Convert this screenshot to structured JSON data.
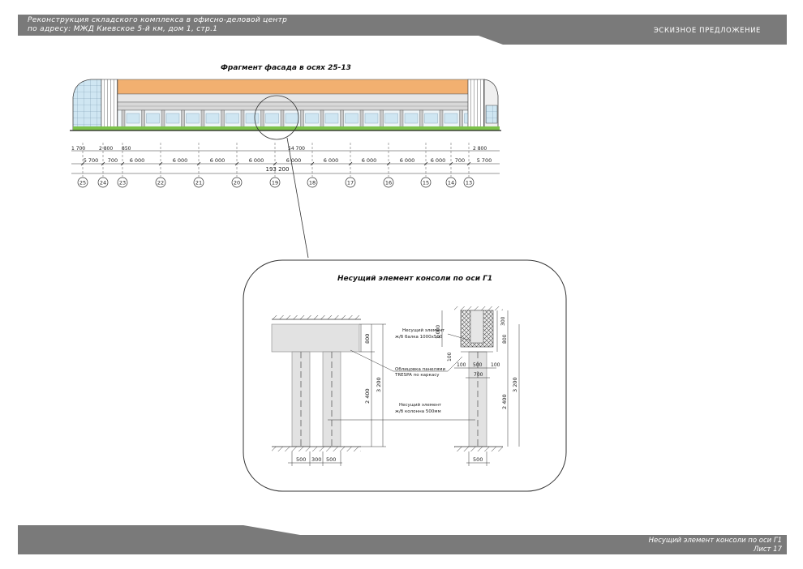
{
  "header": {
    "project_line1": "Реконструкция складского комплекса в офисно-деловой центр",
    "project_line2": "по адресу: МЖД Киевское 5-й км, дом 1, стр.1",
    "stage": "ЭСКИЗНОЕ ПРЕДЛОЖЕНИЕ"
  },
  "facade": {
    "title": "Фрагмент фасада в осях 25-13",
    "dims_top": [
      "1 700",
      "2 800",
      "850",
      "54 700",
      "2 800"
    ],
    "dims_spans": [
      "5 700",
      "700",
      "6 000",
      "6 000",
      "6 000",
      "6 000",
      "6 000",
      "6 000",
      "6 000",
      "6 000",
      "6 000",
      "700",
      "5 700"
    ],
    "dim_total": "193 200",
    "axes": [
      "25",
      "24",
      "23",
      "22",
      "21",
      "20",
      "19",
      "18",
      "17",
      "16",
      "15",
      "14",
      "13"
    ]
  },
  "detail": {
    "title": "Несущий элемент консоли по оси Г1",
    "left_dims": {
      "beam_h": "800",
      "col_h": "2 400",
      "total_h": "3 200",
      "bottom": [
        "500",
        "300",
        "500"
      ]
    },
    "right_dims": {
      "top_h": "300",
      "beam_h": "800",
      "inner_h": "1 000",
      "col_h": "2 400",
      "total_h": "3 200",
      "side1": "100",
      "side2": "100",
      "mid": "500",
      "width": "700",
      "bottom": "500",
      "small": "100"
    },
    "labels": {
      "beam": [
        "Несущий элемент",
        "ж/б балка 1000х500"
      ],
      "panel": [
        "Облицовка панелями",
        "TRESPA по каркасу"
      ],
      "column": [
        "Несущий элемент",
        "ж/б колонна 500мм"
      ]
    }
  },
  "footer": {
    "sheet_title": "Несущий элемент консоли по оси Г1",
    "sheet_number": "Лист 17"
  },
  "colors": {
    "band": "#7a7a7a",
    "roof": "#f2b070",
    "green": "#7cc24a",
    "glass": "#cfe6f2"
  }
}
